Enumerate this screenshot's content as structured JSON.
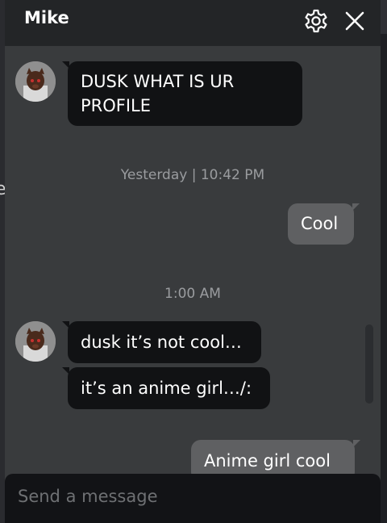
{
  "header": {
    "title": "Mike",
    "settings_icon": "gear-icon",
    "close_icon": "close-icon"
  },
  "messages": [
    {
      "sender": "other",
      "text": "DUSK WHAT IS UR PROFILE"
    },
    {
      "sender": "me",
      "text": "Cool"
    },
    {
      "sender": "other",
      "text": "dusk it’s not cool…"
    },
    {
      "sender": "other",
      "text": "it’s an anime girl…/:"
    },
    {
      "sender": "me",
      "text": "Anime girl cool"
    }
  ],
  "timestamps": [
    "Yesterday | 10:42 PM",
    "1:00 AM"
  ],
  "composer": {
    "placeholder": "Send a message"
  },
  "colors": {
    "header_bg": "#232527",
    "chat_bg": "#393b3d",
    "incoming_bubble": "#111214",
    "outgoing_bubble": "#5f6062",
    "timestamp_text": "#9a9c9f"
  }
}
